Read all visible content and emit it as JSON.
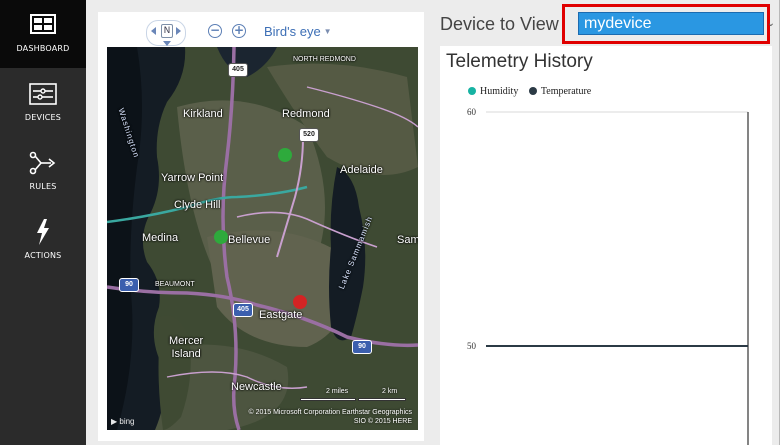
{
  "nav": {
    "items": [
      {
        "label": "DASHBOARD",
        "icon": "dashboard-icon",
        "active": true
      },
      {
        "label": "DEVICES",
        "icon": "devices-icon",
        "active": false
      },
      {
        "label": "RULES",
        "icon": "rules-icon",
        "active": false
      },
      {
        "label": "ACTIONS",
        "icon": "actions-icon",
        "active": false
      }
    ]
  },
  "map": {
    "compass_label": "N",
    "zoom_out_glyph": "−",
    "zoom_in_glyph": "+",
    "view_mode": "Bird's eye",
    "labels": {
      "north_redmond": "NORTH REDMOND",
      "washington": "Washington",
      "kirkland": "Kirkland",
      "redmond": "Redmond",
      "yarrow_point": "Yarrow Point",
      "adelaide": "Adelaide",
      "clyde_hill": "Clyde Hill",
      "lake_sammamish": "Lake Sammamish",
      "medina": "Medina",
      "bellevue": "Bellevue",
      "sam": "Sam",
      "beaumont": "BEAUMONT",
      "eastgate": "Eastgate",
      "mercer_island": "Mercer\nIsland",
      "newcastle": "Newcastle"
    },
    "highways": {
      "h405_top": "405",
      "h520": "520",
      "h90_left": "90",
      "h405_bottom": "405",
      "h90_right": "90"
    },
    "scale": {
      "miles": "2 miles",
      "km": "2 km"
    },
    "logo": "bing",
    "copyright_line1": "© 2015 Microsoft Corporation    Earthstar Geographics",
    "copyright_line2": "SIO   © 2015 HERE",
    "markers": [
      {
        "name": "device-marker-redmond",
        "color": "#2eaa3c"
      },
      {
        "name": "device-marker-bellevue",
        "color": "#2eaa3c"
      },
      {
        "name": "device-marker-eastgate",
        "color": "#d42424"
      }
    ]
  },
  "device_selector": {
    "label": "Device to View",
    "value": "mydevice",
    "highlight_color": "#e00000",
    "select_color": "#2a97e2"
  },
  "telemetry": {
    "title": "Telemetry History",
    "legend": [
      {
        "name": "Humidity",
        "color": "#17b3a3"
      },
      {
        "name": "Temperature",
        "color": "#2b3a45"
      }
    ]
  },
  "chart_data": {
    "type": "line",
    "title": "Telemetry History",
    "series": [
      {
        "name": "Humidity",
        "color": "#17b3a3",
        "values": []
      },
      {
        "name": "Temperature",
        "color": "#2b3a45",
        "values": [
          50,
          50
        ]
      }
    ],
    "ylim": [
      50,
      60
    ],
    "yticks": [
      "60",
      "50"
    ],
    "legend": "top-left"
  }
}
